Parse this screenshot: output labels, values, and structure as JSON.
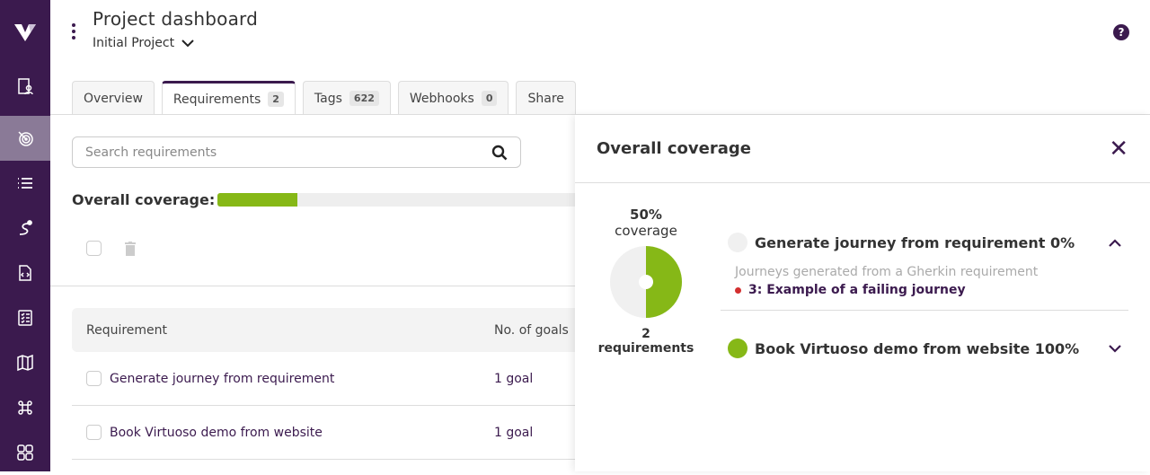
{
  "header": {
    "title": "Project dashboard",
    "project": "Initial Project",
    "help_icon": "?"
  },
  "tabs": [
    {
      "label": "Overview"
    },
    {
      "label": "Requirements",
      "count": "2",
      "active": true
    },
    {
      "label": "Tags",
      "count": "622"
    },
    {
      "label": "Webhooks",
      "count": "0"
    },
    {
      "label": "Share"
    }
  ],
  "sidebar": {
    "items": [
      "project-icon",
      "requirements-target-icon",
      "list-icon",
      "journey-path-icon",
      "code-file-icon",
      "checklist-icon",
      "map-icon",
      "command-icon",
      "apps-grid-icon"
    ]
  },
  "main": {
    "search_placeholder": "Search requirements",
    "coverage_label": "Overall coverage:",
    "coverage_percent": 50,
    "table": {
      "headers": [
        "Requirement",
        "No. of goals"
      ],
      "rows": [
        {
          "name": "Generate journey from requirement",
          "goals": "1 goal"
        },
        {
          "name": "Book Virtuoso demo from website",
          "goals": "1 goal"
        }
      ]
    }
  },
  "panel": {
    "title": "Overall coverage",
    "coverage_value": "50%",
    "coverage_word": "coverage",
    "coverage_fraction": 0.5,
    "requirements_count": "2 requirements",
    "colors": {
      "covered": "#86b817",
      "uncovered": "#f0f0f0",
      "failing": "#d32f2f",
      "brand": "#3b1a4e"
    },
    "items": [
      {
        "title": "Generate journey from requirement 0%",
        "status": "uncovered",
        "expanded": true,
        "description": "Journeys generated from a Gherkin requirement",
        "journeys": [
          {
            "label": "3: Example of a failing journey",
            "status": "failing"
          }
        ]
      },
      {
        "title": "Book Virtuoso demo from website 100%",
        "status": "covered",
        "expanded": false
      }
    ]
  }
}
